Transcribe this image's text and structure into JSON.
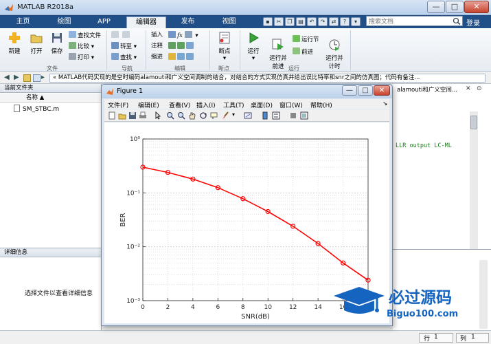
{
  "window": {
    "title": "MATLAB R2018a",
    "min": "—",
    "max": "□",
    "close": "✕"
  },
  "tabs": [
    {
      "label": "主页"
    },
    {
      "label": "绘图"
    },
    {
      "label": "APP"
    },
    {
      "label": "编辑器"
    },
    {
      "label": "发布"
    },
    {
      "label": "视图"
    }
  ],
  "search": {
    "placeholder": "搜索文档"
  },
  "login": "登录",
  "ribbon": {
    "file": {
      "new": "新建",
      "open": "打开",
      "save": "保存",
      "find_files": "查找文件",
      "compare": "比较",
      "print": "打印",
      "group": "文件"
    },
    "navigate": {
      "goto": "转至",
      "find": "查找",
      "group": "导航"
    },
    "edit": {
      "insert": "插入",
      "comment": "注释",
      "indent": "缩进",
      "fx": "fx",
      "group": "编辑"
    },
    "breakpoints": {
      "label": "断点",
      "group": "断点"
    },
    "run": {
      "run": "运行",
      "run_advance": "运行并\n前进",
      "run_section": "运行节",
      "advance": "前进",
      "run_time": "运行并\n计时",
      "group": "运行"
    }
  },
  "address": {
    "path": "«  MATLAB代码实现的是空时编码alamouti和广义空间调制的结合，对结合的方式实现仿真并给出误比特率和snr之间的仿真图；代码有备注..."
  },
  "current_folder": {
    "title": "当前文件夹",
    "column": "名称 ▲",
    "file": "SM_STBC.m"
  },
  "details": {
    "title": "详细信息",
    "message": "选择文件以查看详细信息"
  },
  "editor": {
    "title_fragment": "alamouti和广义空间...",
    "code_fragment": "LLR output LC-ML"
  },
  "status": {
    "row_label": "行",
    "row_value": "1",
    "col_label": "列",
    "col_value": "1"
  },
  "figure": {
    "title": "Figure 1",
    "menu": [
      "文件(F)",
      "编辑(E)",
      "查看(V)",
      "插入(I)",
      "工具(T)",
      "桌面(D)",
      "窗口(W)",
      "帮助(H)"
    ],
    "colors": {
      "line": "#ff0000",
      "grid": "#d9d9d9"
    }
  },
  "watermark": {
    "brand": "必过源码",
    "domain": "Biguo100.com"
  },
  "chart_data": {
    "type": "line",
    "xlabel": "SNR(dB)",
    "ylabel": "BER",
    "yscale": "log",
    "xlim": [
      0,
      18
    ],
    "ylim": [
      0.001,
      1
    ],
    "xticks": [
      "0",
      "2",
      "4",
      "6",
      "8",
      "10",
      "12",
      "14",
      "16",
      "18"
    ],
    "yticks": [
      "10⁰",
      "10⁻¹",
      "10⁻²",
      "10⁻³"
    ],
    "grid": true,
    "series": [
      {
        "marker": "circle",
        "color": "#ff0000",
        "x": [
          0,
          2,
          4,
          6,
          8,
          10,
          12,
          14,
          16,
          18
        ],
        "y": [
          0.3,
          0.24,
          0.18,
          0.125,
          0.078,
          0.045,
          0.024,
          0.0115,
          0.005,
          0.0024
        ]
      }
    ]
  }
}
